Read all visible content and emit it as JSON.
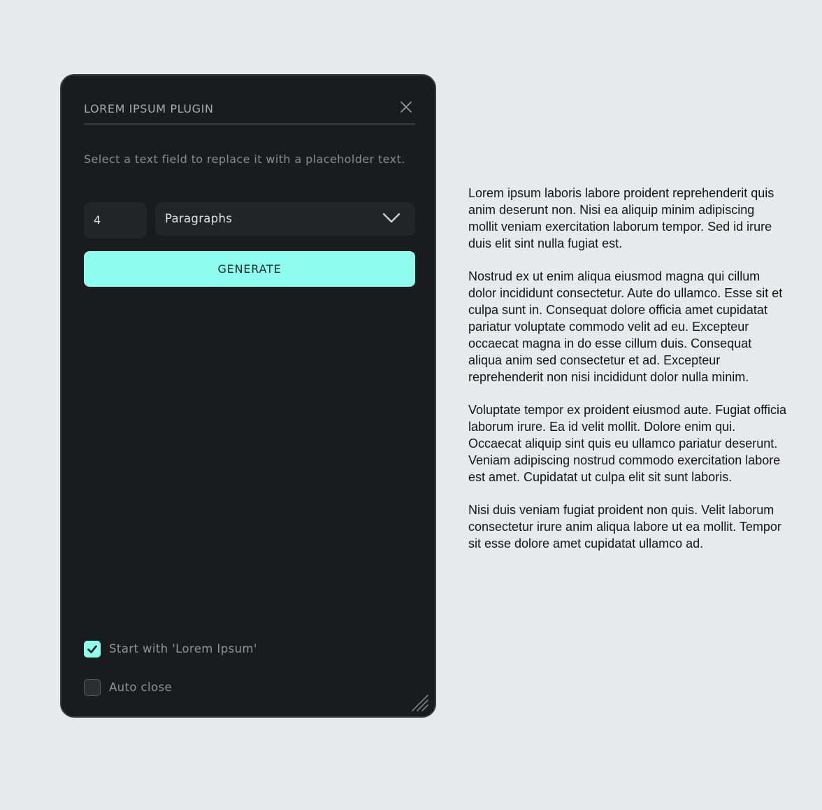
{
  "plugin": {
    "title": "LOREM IPSUM PLUGIN",
    "description": "Select a text field to replace it with a placeholder text.",
    "count_value": "4",
    "unit_selected": "Paragraphs",
    "generate_label": "GENERATE",
    "options": [
      {
        "label": "Start with 'Lorem Ipsum'",
        "checked": true
      },
      {
        "label": "Auto close",
        "checked": false
      }
    ],
    "icons": {
      "close": "close-icon",
      "chevron": "chevron-down-icon",
      "check": "checkmark-icon",
      "resize": "resize-handle-icon"
    },
    "colors": {
      "accent": "#8ffcee",
      "panel_bg": "#1a1b1d",
      "field_bg": "#222427"
    }
  },
  "preview": {
    "paragraphs": [
      "Lorem ipsum laboris labore proident reprehenderit quis anim deserunt non. Nisi ea aliquip minim adipiscing mollit veniam exercitation laborum tempor. Sed id irure duis elit sint nulla fugiat est.",
      "Nostrud ex ut enim aliqua eiusmod magna qui cillum dolor incididunt consectetur. Aute do ullamco. Esse sit et culpa sunt in. Consequat dolore officia amet cupidatat pariatur voluptate commodo velit ad eu. Excepteur occaecat magna in do esse cillum duis. Consequat aliqua anim sed consectetur et ad. Excepteur reprehenderit non nisi incididunt dolor nulla minim.",
      "Voluptate tempor ex proident eiusmod aute. Fugiat officia laborum irure. Ea id velit mollit. Dolore enim qui. Occaecat aliquip sint quis eu ullamco pariatur deserunt. Veniam adipiscing nostrud commodo exercitation labore est amet. Cupidatat ut culpa elit sit sunt laboris.",
      "Nisi duis veniam fugiat proident non quis. Velit laborum consectetur irure anim aliqua labore ut ea mollit. Tempor sit esse dolore amet cupidatat ullamco ad."
    ]
  }
}
